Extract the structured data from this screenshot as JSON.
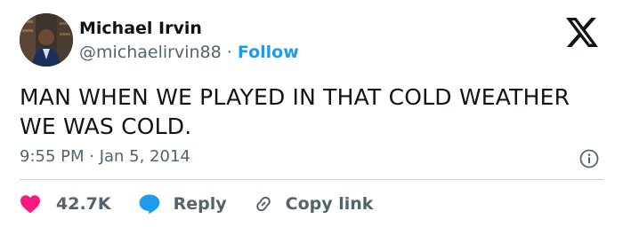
{
  "tweet": {
    "author": {
      "display_name": "Michael Irvin",
      "handle": "@michaelirvin88",
      "separator": "·",
      "follow_label": "Follow",
      "avatar": "user-avatar-photo"
    },
    "logo": "x-logo-icon",
    "text": "MAN WHEN WE PLAYED IN THAT COLD WEATHER WE WAS COLD.",
    "timestamp": "9:55 PM · Jan 5, 2014",
    "info_icon": "info-icon",
    "actions": {
      "like_count": "42.7K",
      "reply_label": "Reply",
      "copy_link_label": "Copy link"
    }
  },
  "colors": {
    "accent": "#1d9bf0",
    "like": "#f91880",
    "text": "#0f1419",
    "muted": "#536471",
    "divider": "#cfd9de"
  }
}
